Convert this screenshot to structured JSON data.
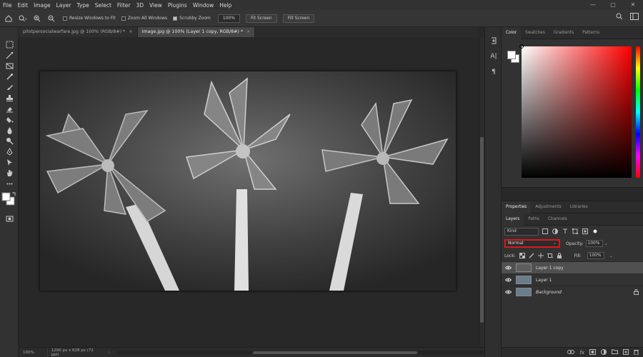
{
  "menu": {
    "items": [
      "File",
      "Edit",
      "Image",
      "Layer",
      "Type",
      "Select",
      "Filter",
      "3D",
      "View",
      "Plugins",
      "Window",
      "Help"
    ],
    "controls": [
      "—",
      "▢",
      "✕"
    ]
  },
  "options": {
    "resize_windows": "Resize Windows to Fit",
    "zoom_all": "Zoom All Windows",
    "scrubby_zoom": "Scrubby Zoom",
    "zoom_value": "100%",
    "fit_screen": "Fit Screen",
    "fill_screen": "Fill Screen"
  },
  "tabs": [
    {
      "label": "pilotpersocialwarfare.jpg @ 100% (RGB/8#) *",
      "close": "×"
    },
    {
      "label": "Image.jpg @ 100% (Layer 1 copy, RGB/8#) *",
      "close": "×"
    }
  ],
  "status": {
    "zoom": "100%",
    "info": "1200 px x 628 px (72 ppi)",
    "chevron": "›"
  },
  "panel_strip": {
    "char_icon": "A|",
    "para_icon": "¶"
  },
  "color_panel": {
    "tabs": [
      "Color",
      "Swatches",
      "Gradients",
      "Patterns"
    ]
  },
  "props_panel": {
    "tabs": [
      "Properties",
      "Adjustments",
      "Libraries"
    ]
  },
  "layers_panel": {
    "tabs": [
      "Layers",
      "Paths",
      "Channels"
    ],
    "kind": "Kind",
    "blend_mode": "Normal",
    "opacity_label": "Opacity:",
    "opacity_value": "100%",
    "lock_label": "Lock:",
    "fill_label": "Fill:",
    "fill_value": "100%",
    "layers": [
      {
        "name": "Layer 1 copy",
        "selected": true
      },
      {
        "name": "Layer 1",
        "selected": false
      },
      {
        "name": "Background",
        "selected": false,
        "locked": true
      }
    ]
  },
  "colors": {
    "accent_highlight": "#e0161a",
    "panel_bg": "#323232"
  }
}
